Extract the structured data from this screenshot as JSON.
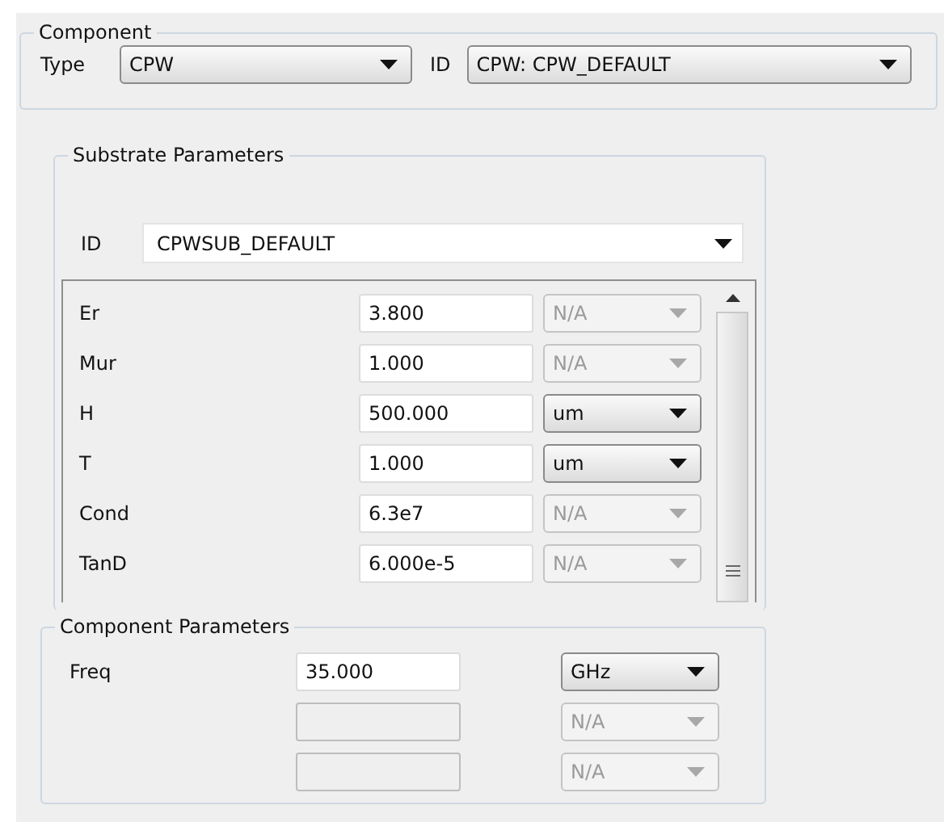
{
  "component": {
    "title": "Component",
    "type_label": "Type",
    "type_value": "CPW",
    "id_label": "ID",
    "id_value": "CPW: CPW_DEFAULT"
  },
  "substrate": {
    "title": "Substrate Parameters",
    "id_label": "ID",
    "id_value": "CPWSUB_DEFAULT",
    "rows": [
      {
        "name": "Er",
        "value": "3.800",
        "unit": "N/A",
        "unit_disabled": true
      },
      {
        "name": "Mur",
        "value": "1.000",
        "unit": "N/A",
        "unit_disabled": true
      },
      {
        "name": "H",
        "value": "500.000",
        "unit": "um",
        "unit_disabled": false
      },
      {
        "name": "T",
        "value": "1.000",
        "unit": "um",
        "unit_disabled": false
      },
      {
        "name": "Cond",
        "value": "6.3e7",
        "unit": "N/A",
        "unit_disabled": true
      },
      {
        "name": "TanD",
        "value": "6.000e-5",
        "unit": "N/A",
        "unit_disabled": true
      }
    ]
  },
  "component_parameters": {
    "title": "Component Parameters",
    "rows": [
      {
        "name": "Freq",
        "value": "35.000",
        "value_disabled": false,
        "unit": "GHz",
        "unit_disabled": false
      },
      {
        "value_disabled": true,
        "unit": "N/A",
        "unit_disabled": true
      },
      {
        "value_disabled": true,
        "unit": "N/A",
        "unit_disabled": true
      }
    ]
  }
}
